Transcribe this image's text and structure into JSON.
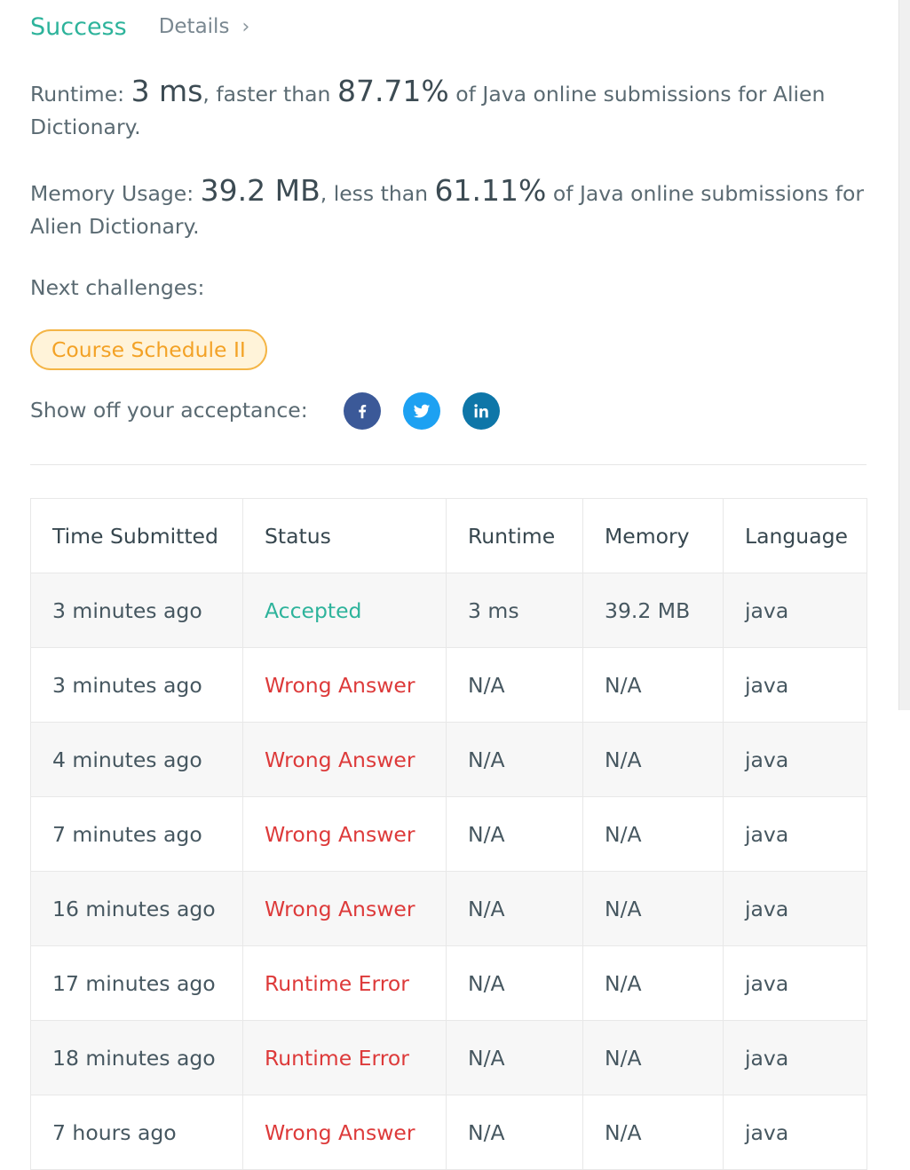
{
  "header": {
    "status": "Success",
    "details_link": "Details",
    "details_chevron": "›"
  },
  "runtime_stat": {
    "label": "Runtime:",
    "value": "3 ms",
    "middle": ", faster than",
    "percent": "87.71%",
    "tail": "of Java online submissions for Alien Dictionary."
  },
  "memory_stat": {
    "label": "Memory Usage:",
    "value": "39.2 MB",
    "middle": ", less than",
    "percent": "61.11%",
    "tail": "of Java online submissions for Alien Dictionary."
  },
  "next": {
    "label": "Next challenges:",
    "challenge": "Course Schedule II"
  },
  "share": {
    "label": "Show off your acceptance:",
    "icons": [
      "facebook-icon",
      "twitter-icon",
      "linkedin-icon"
    ]
  },
  "table": {
    "headers": [
      "Time Submitted",
      "Status",
      "Runtime",
      "Memory",
      "Language"
    ],
    "rows": [
      {
        "time": "3 minutes ago",
        "status": "Accepted",
        "status_type": "accepted",
        "runtime": "3 ms",
        "memory": "39.2 MB",
        "language": "java"
      },
      {
        "time": "3 minutes ago",
        "status": "Wrong Answer",
        "status_type": "wrong",
        "runtime": "N/A",
        "memory": "N/A",
        "language": "java"
      },
      {
        "time": "4 minutes ago",
        "status": "Wrong Answer",
        "status_type": "wrong",
        "runtime": "N/A",
        "memory": "N/A",
        "language": "java"
      },
      {
        "time": "7 minutes ago",
        "status": "Wrong Answer",
        "status_type": "wrong",
        "runtime": "N/A",
        "memory": "N/A",
        "language": "java"
      },
      {
        "time": "16 minutes ago",
        "status": "Wrong Answer",
        "status_type": "wrong",
        "runtime": "N/A",
        "memory": "N/A",
        "language": "java"
      },
      {
        "time": "17 minutes ago",
        "status": "Runtime Error",
        "status_type": "error",
        "runtime": "N/A",
        "memory": "N/A",
        "language": "java"
      },
      {
        "time": "18 minutes ago",
        "status": "Runtime Error",
        "status_type": "error",
        "runtime": "N/A",
        "memory": "N/A",
        "language": "java"
      },
      {
        "time": "7 hours ago",
        "status": "Wrong Answer",
        "status_type": "wrong",
        "runtime": "N/A",
        "memory": "N/A",
        "language": "java"
      }
    ]
  },
  "colors": {
    "success": "#2db39b",
    "error": "#dd3a3a",
    "pill_border": "#f4b546",
    "pill_text": "#f3a226",
    "facebook": "#3b5998",
    "twitter": "#1da1f2",
    "linkedin": "#0e76a8"
  }
}
